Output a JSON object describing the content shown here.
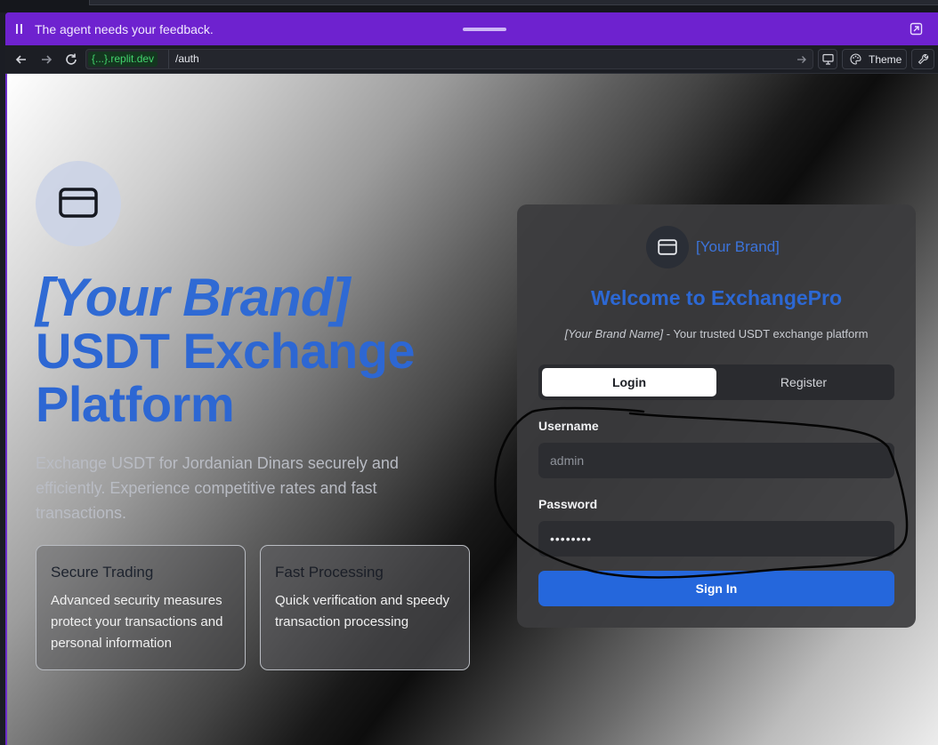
{
  "feedback_bar": {
    "message": "The agent needs your feedback."
  },
  "browser": {
    "url_host": "{...}.replit.dev",
    "url_path": "/auth",
    "theme_label": "Theme"
  },
  "hero": {
    "brand": "[Your Brand]",
    "title": "USDT Exchange Platform",
    "description": "Exchange USDT for Jordanian Dinars securely and efficiently. Experience competitive rates and fast transactions.",
    "features": [
      {
        "title": "Secure Trading",
        "text": "Advanced security measures protect your transactions and personal information"
      },
      {
        "title": "Fast Processing",
        "text": "Quick verification and speedy transaction processing"
      }
    ]
  },
  "auth_card": {
    "brand": "[Your Brand]",
    "title": "Welcome to ExchangePro",
    "subtitle_brand": "[Your Brand Name]",
    "subtitle_rest": " - Your trusted USDT exchange platform",
    "tabs": [
      {
        "label": "Login",
        "active": true
      },
      {
        "label": "Register",
        "active": false
      }
    ],
    "username_label": "Username",
    "username_value": "admin",
    "password_label": "Password",
    "password_value": "••••••••",
    "submit_label": "Sign In"
  },
  "colors": {
    "accent": "#2567dc",
    "brand_text": "#2f6ad4",
    "feedback_bar": "#6e22cf",
    "url_host_green": "#43d36d"
  },
  "icons": [
    "pause-icon",
    "popout-icon",
    "back-arrow-icon",
    "forward-arrow-icon",
    "reload-icon",
    "go-arrow-icon",
    "monitor-icon",
    "palette-icon",
    "wrench-icon",
    "credit-card-icon"
  ]
}
